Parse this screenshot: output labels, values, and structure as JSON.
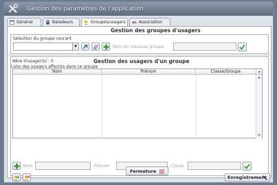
{
  "window": {
    "title": "Gestion des paramètres de l'application"
  },
  "tabs": [
    {
      "label": "Général",
      "icon": "calendar-icon"
    },
    {
      "label": "Baladeurs",
      "icon": "device-icon"
    },
    {
      "label": "Groupes/usagers",
      "icon": "group-icon"
    },
    {
      "label": "Association",
      "icon": "association-icon"
    }
  ],
  "groups": {
    "title": "Gestion des groupes d'usagers",
    "select_label": "Sélection du groupe courant",
    "selected_value": "",
    "new_group_placeholder": "Nom du nouveau groupe",
    "new_group_value": ""
  },
  "users": {
    "count_label": "Nbre d'usager(s) :",
    "count": "0",
    "title": "Gestion des usagers d'un groupe",
    "list_label": "Liste des usagers affectés dans ce groupe",
    "columns": [
      "Nom",
      "Prénom",
      "Classe/Groupe"
    ],
    "rows": [],
    "form": {
      "nom_label": "Nom",
      "prenom_label": "Prénom",
      "classe_label": "Classe"
    },
    "save_label": "Enregistrement"
  },
  "footer": {
    "close_label": "Fermeture"
  }
}
